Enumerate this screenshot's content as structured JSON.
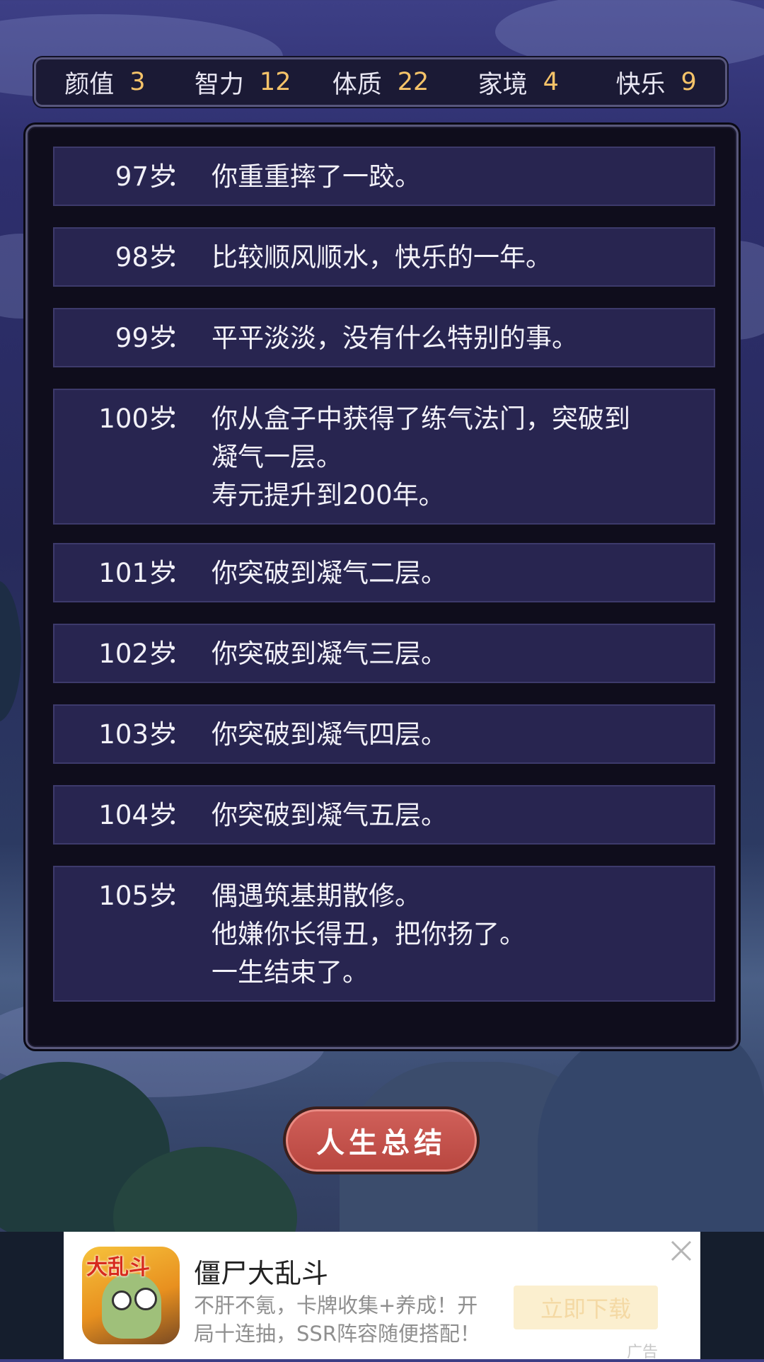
{
  "stats": [
    {
      "label": "颜值",
      "value": "3"
    },
    {
      "label": "智力",
      "value": "12"
    },
    {
      "label": "体质",
      "value": "22"
    },
    {
      "label": "家境",
      "value": "4"
    },
    {
      "label": "快乐",
      "value": "9"
    }
  ],
  "entries": [
    {
      "age": "97岁",
      "lines": [
        "你重重摔了一跤。"
      ]
    },
    {
      "age": "98岁",
      "lines": [
        "比较顺风顺水，快乐的一年。"
      ]
    },
    {
      "age": "99岁",
      "lines": [
        "平平淡淡，没有什么特别的事。"
      ]
    },
    {
      "age": "100岁",
      "lines": [
        "你从盒子中获得了练气法门，突破到",
        "凝气一层。",
        "寿元提升到200年。"
      ]
    },
    {
      "age": "101岁",
      "lines": [
        "你突破到凝气二层。"
      ]
    },
    {
      "age": "102岁",
      "lines": [
        "你突破到凝气三层。"
      ]
    },
    {
      "age": "103岁",
      "lines": [
        "你突破到凝气四层。"
      ]
    },
    {
      "age": "104岁",
      "lines": [
        "你突破到凝气五层。"
      ]
    },
    {
      "age": "105岁",
      "lines": [
        "偶遇筑基期散修。",
        "他嫌你长得丑，把你扬了。",
        "一生结束了。"
      ]
    }
  ],
  "age_suffix": "：",
  "summary_button": "人生总结",
  "ad": {
    "icon_text": "大乱斗",
    "title": "僵尸大乱斗",
    "description": "不肝不氪，卡牌收集+养成！开局十连抽，SSR阵容随便搭配！",
    "cta": "立即下载",
    "tag": "广告"
  },
  "colors": {
    "stat_value": "#f5c369",
    "entry_bg": "#282550",
    "panel_bg": "#0f0d1c",
    "button": "#c0504a"
  }
}
